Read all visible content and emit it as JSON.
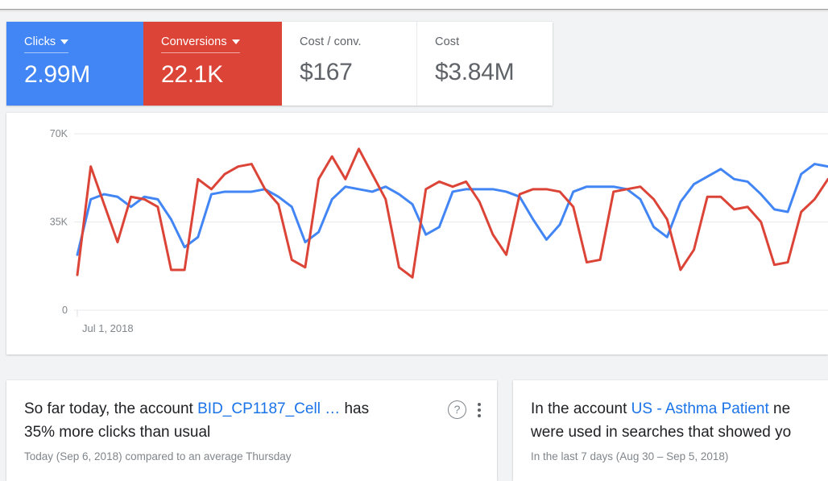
{
  "scorecards": [
    {
      "label": "Clicks",
      "value": "2.99M",
      "selected": true,
      "color": "#4285f4",
      "has_dropdown": true
    },
    {
      "label": "Conversions",
      "value": "22.1K",
      "selected": true,
      "color": "#db4437",
      "has_dropdown": true
    },
    {
      "label": "Cost / conv.",
      "value": "$167",
      "selected": false,
      "color": "#5f6368",
      "has_dropdown": false
    },
    {
      "label": "Cost",
      "value": "$3.84M",
      "selected": false,
      "color": "#5f6368",
      "has_dropdown": false
    }
  ],
  "chart_data": {
    "type": "line",
    "title": "",
    "xlabel": "",
    "ylabel": "",
    "grid": true,
    "legend_position": "none",
    "ylim": [
      0,
      70000
    ],
    "yticks": [
      0,
      35000,
      70000
    ],
    "ytick_labels": [
      "0",
      "35K",
      "70K"
    ],
    "xtick_labels": [
      "Jul 1, 2018"
    ],
    "x_start": "Jul 1, 2018",
    "series": [
      {
        "name": "Clicks",
        "color": "#4285f4",
        "values": [
          22000,
          44000,
          46000,
          45000,
          41000,
          45000,
          44000,
          36000,
          25000,
          29000,
          46000,
          47000,
          47000,
          47000,
          48000,
          45000,
          41000,
          27000,
          31000,
          44000,
          49000,
          48000,
          47000,
          49000,
          46000,
          42000,
          30000,
          33000,
          47000,
          48000,
          48000,
          48000,
          47000,
          45000,
          36000,
          28000,
          34000,
          47000,
          49000,
          49000,
          49000,
          48000,
          44000,
          33000,
          29000,
          43000,
          50000,
          53000,
          56000,
          52000,
          51000,
          46000,
          40000,
          39000,
          54000,
          58000,
          57000
        ]
      },
      {
        "name": "Conversions",
        "color": "#db4437",
        "values": [
          14000,
          57000,
          42000,
          27000,
          45000,
          44000,
          41000,
          16000,
          16000,
          52000,
          48000,
          54000,
          57000,
          58000,
          48000,
          42000,
          20000,
          17000,
          52000,
          61000,
          52000,
          64000,
          54000,
          44000,
          17000,
          13000,
          48000,
          51000,
          49000,
          51000,
          43000,
          30000,
          22000,
          46000,
          48000,
          48000,
          47000,
          41000,
          19000,
          20000,
          47000,
          48000,
          49000,
          44000,
          36000,
          16000,
          24000,
          45000,
          45000,
          40000,
          41000,
          35000,
          18000,
          19000,
          39000,
          44000,
          52000
        ]
      }
    ]
  },
  "insights": [
    {
      "line1_pre": "So far today, the account ",
      "account": "BID_CP1187_Cell …",
      "line1_post": "  has",
      "line2": "35% more clicks than usual",
      "subtitle": "Today (Sep 6, 2018) compared to an average Thursday",
      "help_icon": "help-circle-icon",
      "menu_icon": "more-vert-icon"
    },
    {
      "line1_pre": "In the account ",
      "account": "US - Asthma Patient",
      "line1_post": " ne",
      "line2": "were used in searches that showed yo",
      "subtitle": "In the last 7 days (Aug 30 – Sep 5, 2018)",
      "help_icon": "",
      "menu_icon": ""
    }
  ]
}
